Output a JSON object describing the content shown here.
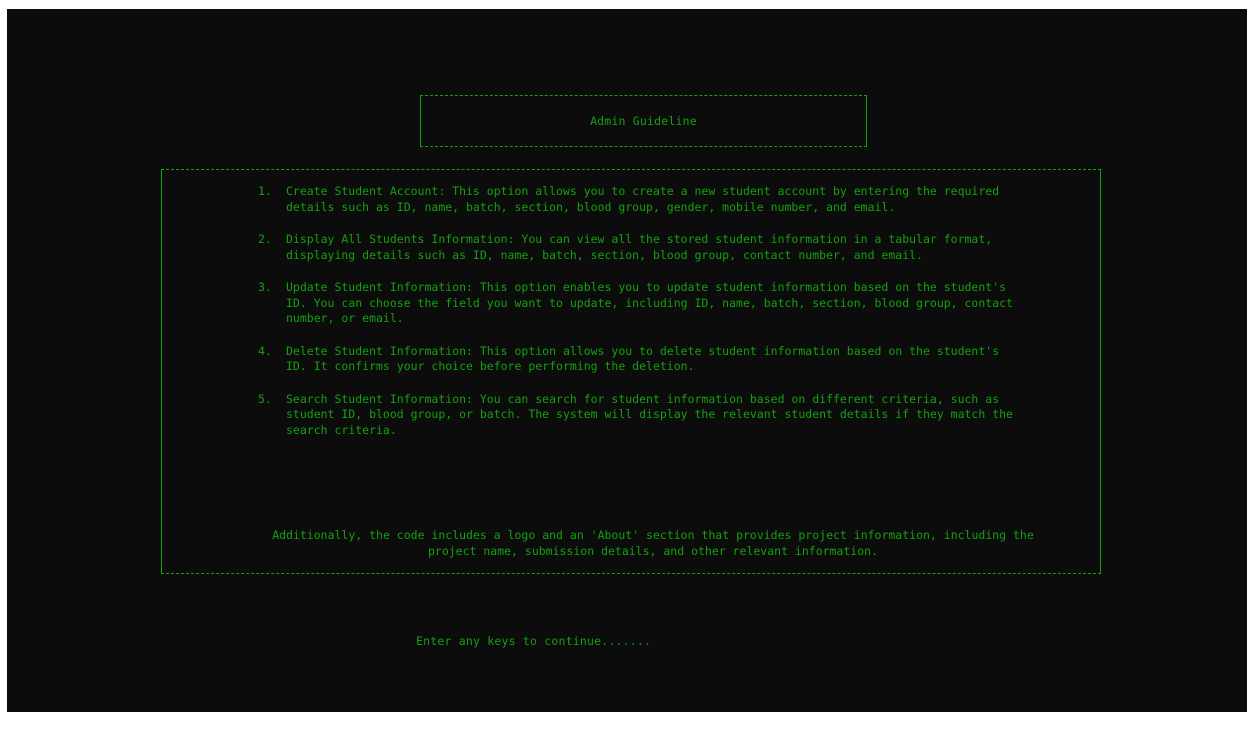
{
  "title": "Admin Guideline",
  "items": [
    {
      "number": "1.",
      "text": "Create Student Account: This option allows you to create a new student account by entering the required details such as ID, name, batch, section, blood group, gender, mobile number, and email."
    },
    {
      "number": "2.",
      "text": "Display All Students Information: You can view all the stored student information in a tabular format, displaying details such as ID, name, batch, section, blood group, contact number, and email."
    },
    {
      "number": "3.",
      "text": "Update Student Information: This option enables you to update student information based on the student's ID. You can choose the field you want to update, including ID, name, batch, section, blood group, contact number, or email."
    },
    {
      "number": "4.",
      "text": "Delete Student Information: This option allows you to delete student information based on the student's ID. It confirms your choice before performing the deletion."
    },
    {
      "number": "5.",
      "text": "Search Student Information: You can search for student information based on different criteria, such as student ID, blood group, or batch. The system will display the relevant student details if they match the search criteria."
    }
  ],
  "note": "Additionally, the code includes a logo and an 'About' section that provides project information, including the project name, submission details, and other relevant information.",
  "prompt": "Enter any keys to continue.......",
  "colors": {
    "background": "#0c0c0c",
    "text": "#13a10e"
  }
}
